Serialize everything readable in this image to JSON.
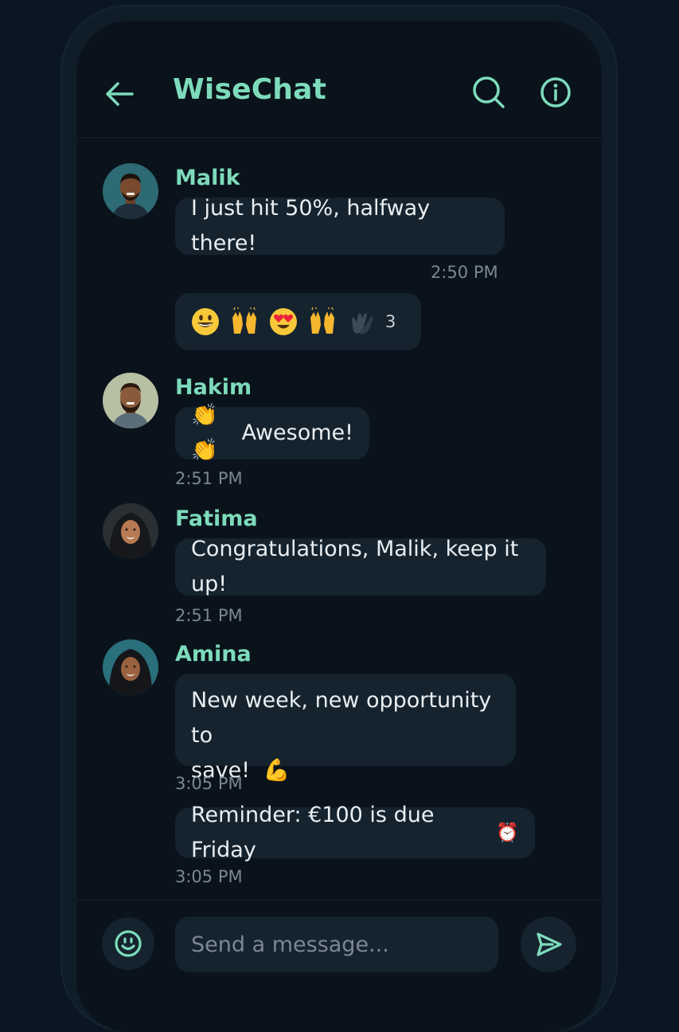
{
  "colors": {
    "accent": "#7ddbbb",
    "background": "#0a131b",
    "bubble": "#15232e"
  },
  "header": {
    "title": "WiseChat",
    "back_icon": "arrow-left-icon",
    "search_icon": "search-icon",
    "info_icon": "info-icon"
  },
  "messages": [
    {
      "sender": "Malik",
      "text": "I just hit 50%, halfway there!",
      "time": "2:50 PM",
      "reactions": {
        "emojis": [
          "😃",
          "🙌",
          "😍",
          "🙌",
          "👏"
        ],
        "count": "3"
      }
    },
    {
      "sender": "Hakim",
      "emoji": "👏👏",
      "text": "Awesome!",
      "time": "2:51 PM"
    },
    {
      "sender": "Fatima",
      "text": "Congratulations, Malik, keep it up!",
      "time": "2:51 PM"
    },
    {
      "sender": "Amina",
      "text_line1": "New week, new opportunity to",
      "text_line2": "save!",
      "emoji": "💪",
      "time": "3:05 PM"
    },
    {
      "text": "Reminder: €100 is due Friday",
      "emoji": "⏰",
      "time": "3:05 PM"
    }
  ],
  "composer": {
    "placeholder": "Send a message...",
    "emoji_icon": "smiley-icon",
    "send_icon": "send-icon"
  }
}
